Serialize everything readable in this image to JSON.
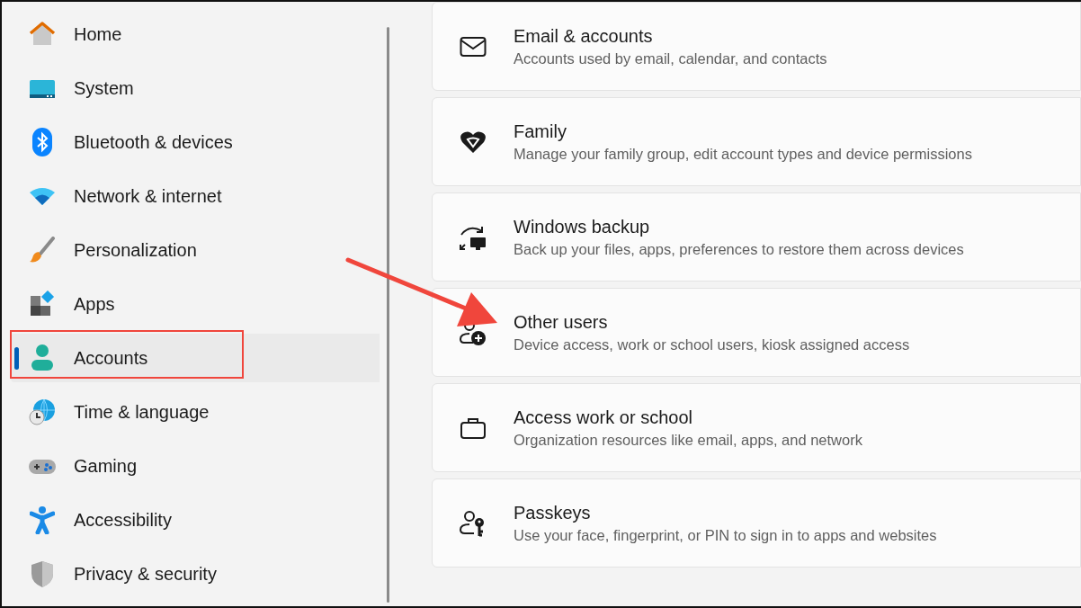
{
  "sidebar": {
    "items": [
      {
        "label": "Home",
        "selected": false
      },
      {
        "label": "System",
        "selected": false
      },
      {
        "label": "Bluetooth & devices",
        "selected": false
      },
      {
        "label": "Network & internet",
        "selected": false
      },
      {
        "label": "Personalization",
        "selected": false
      },
      {
        "label": "Apps",
        "selected": false
      },
      {
        "label": "Accounts",
        "selected": true
      },
      {
        "label": "Time & language",
        "selected": false
      },
      {
        "label": "Gaming",
        "selected": false
      },
      {
        "label": "Accessibility",
        "selected": false
      },
      {
        "label": "Privacy & security",
        "selected": false
      }
    ]
  },
  "settings": [
    {
      "title": "Email & accounts",
      "description": "Accounts used by email, calendar, and contacts"
    },
    {
      "title": "Family",
      "description": "Manage your family group, edit account types and device permissions"
    },
    {
      "title": "Windows backup",
      "description": "Back up your files, apps, preferences to restore them across devices"
    },
    {
      "title": "Other users",
      "description": "Device access, work or school users, kiosk assigned access"
    },
    {
      "title": "Access work or school",
      "description": "Organization resources like email, apps, and network"
    },
    {
      "title": "Passkeys",
      "description": "Use your face, fingerprint, or PIN to sign in to apps and websites"
    }
  ]
}
